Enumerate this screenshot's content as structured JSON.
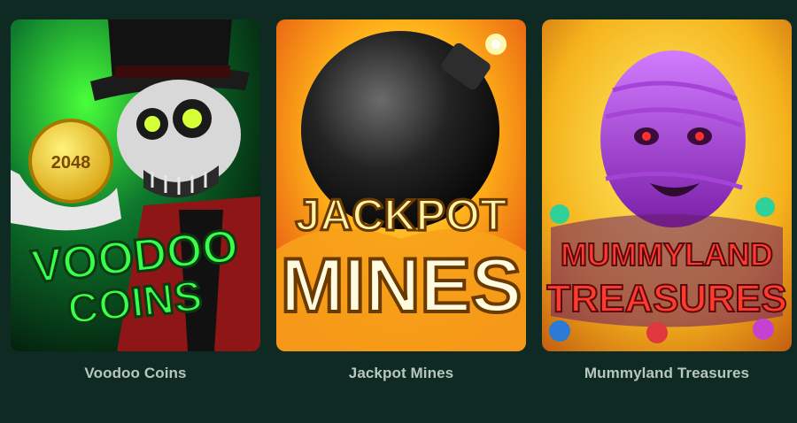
{
  "games": [
    {
      "title": "Voodoo Coins",
      "art_lines": [
        "VOODOO",
        "COINS"
      ],
      "coin_label": "2048",
      "colors": {
        "bg": "#0b5a2a",
        "accent": "#39ff4a",
        "coat": "#b21f1f"
      }
    },
    {
      "title": "Jackpot Mines",
      "art_lines": [
        "JACKPOT",
        "MINES"
      ],
      "colors": {
        "bg": "#f1b518",
        "accent": "#fff26a",
        "bomb": "#1c1c1c"
      }
    },
    {
      "title": "Mummyland Treasures",
      "art_lines": [
        "MUMMYLAND",
        "TREASURES"
      ],
      "colors": {
        "bg": "#f5c51a",
        "accent": "#ff3b2f",
        "mummy": "#b044f0"
      }
    }
  ]
}
